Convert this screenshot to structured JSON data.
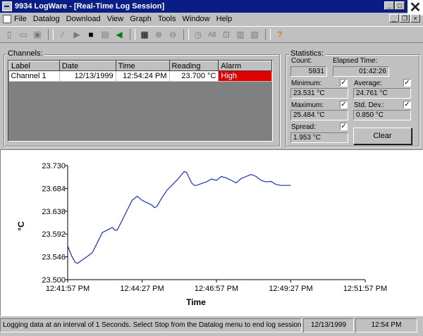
{
  "window": {
    "title": "9934 LogWare - [Real-Time Log Session]"
  },
  "menu": [
    "File",
    "Datalog",
    "Download",
    "View",
    "Graph",
    "Tools",
    "Window",
    "Help"
  ],
  "channels": {
    "group_label": "Channels:",
    "columns": [
      "Label",
      "Date",
      "Time",
      "Reading",
      "Alarm"
    ],
    "row": {
      "label": "Channel 1",
      "date": "12/13/1999",
      "time": "12:54:24 PM",
      "reading": "23.700 °C",
      "alarm": "High"
    }
  },
  "statistics": {
    "group_label": "Statistics:",
    "count_label": "Count:",
    "count": "5931",
    "elapsed_label": "Elapsed Time:",
    "elapsed": "01:42:26",
    "minimum_label": "Minimum:",
    "minimum": "23.531 °C",
    "average_label": "Average:",
    "average": "24.761 °C",
    "maximum_label": "Maximum:",
    "maximum": "25.484 °C",
    "stddev_label": "Std. Dev.:",
    "stddev": "0.850 °C",
    "spread_label": "Spread:",
    "spread": "1.953 °C",
    "clear_label": "Clear"
  },
  "chart_data": {
    "type": "line",
    "xlabel": "Time",
    "ylabel": "°C",
    "y_ticks": [
      "23.730",
      "23.684",
      "23.638",
      "23.592",
      "23.546",
      "23.500"
    ],
    "ylim": [
      23.5,
      23.73
    ],
    "x_ticks": [
      "12:41:57 PM",
      "12:44:27 PM",
      "12:46:57 PM",
      "12:49:27 PM",
      "12:51:57 PM"
    ],
    "xlim": [
      0,
      600
    ],
    "line_color": "#1f2fb5",
    "series": [
      {
        "x": [
          0,
          8,
          15,
          20,
          30,
          40,
          50,
          55,
          60,
          70,
          80,
          90,
          95,
          100,
          110,
          120,
          130,
          140,
          150,
          160,
          170,
          175,
          180,
          190,
          200,
          210,
          220,
          230,
          235,
          240,
          245,
          250,
          255,
          260,
          270,
          280,
          290,
          300,
          310,
          320,
          330,
          340,
          350,
          360,
          370,
          380,
          390,
          400,
          410,
          420,
          430,
          440,
          450
        ],
        "y": [
          23.568,
          23.548,
          23.535,
          23.533,
          23.54,
          23.547,
          23.555,
          23.565,
          23.575,
          23.595,
          23.6,
          23.605,
          23.6,
          23.6,
          23.62,
          23.64,
          23.66,
          23.668,
          23.66,
          23.655,
          23.65,
          23.645,
          23.648,
          23.665,
          23.68,
          23.69,
          23.7,
          23.712,
          23.718,
          23.716,
          23.705,
          23.695,
          23.69,
          23.69,
          23.694,
          23.697,
          23.703,
          23.7,
          23.708,
          23.705,
          23.7,
          23.695,
          23.704,
          23.708,
          23.712,
          23.708,
          23.7,
          23.697,
          23.698,
          23.692,
          23.69,
          23.69,
          23.69
        ]
      }
    ]
  },
  "status": {
    "message": "Logging data at an interval of 1 Seconds. Select Stop from the Datalog menu to end log session.",
    "date": "12/13/1999",
    "time": "12:54 PM"
  }
}
